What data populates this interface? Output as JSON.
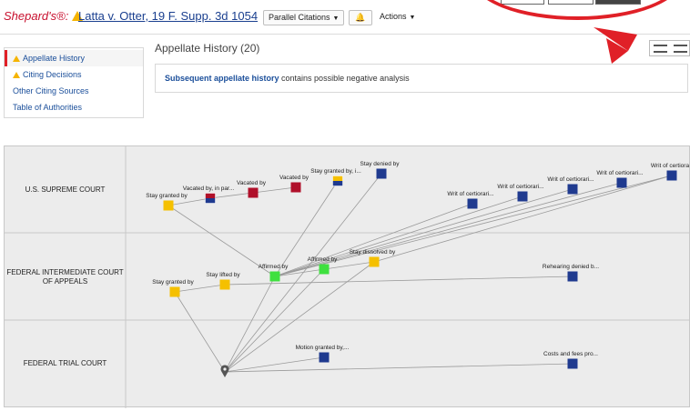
{
  "header": {
    "brand": "Shepard's®:",
    "case_title": "Latta v. Otter, 19 F. Supp. 3d 1054",
    "parallel_citations_label": "Parallel Citations",
    "actions_label": "Actions",
    "warning_color": "#f5b400",
    "brand_color": "#c8102e"
  },
  "sidenav": {
    "items": [
      {
        "label": "Appellate History",
        "warning": true,
        "active": true
      },
      {
        "label": "Citing Decisions",
        "warning": true,
        "active": false
      },
      {
        "label": "Other Citing Sources",
        "warning": false,
        "active": false
      },
      {
        "label": "Table of Authorities",
        "warning": false,
        "active": false
      }
    ]
  },
  "main": {
    "title": "Appellate History (20)",
    "notice_bold": "Subsequent appellate history",
    "notice_rest": " contains possible negative analysis"
  },
  "graph": {
    "courts": [
      "U.S. SUPREME COURT",
      "FEDERAL INTERMEDIATE COURT OF APPEALS",
      "FEDERAL TRIAL COURT"
    ],
    "colors": {
      "navy": "#1f3a8f",
      "yellow": "#f5c000",
      "green": "#3fe03f",
      "crimson": "#b0102a",
      "edge": "#9a9a9a"
    },
    "nodes": [
      {
        "id": "origin",
        "label": "",
        "kind": "pin"
      },
      {
        "id": "n1",
        "label": "Stay granted by",
        "kind": "yellow"
      },
      {
        "id": "n2",
        "label": "Vacated by, in par...",
        "kind": "split-crimson"
      },
      {
        "id": "n3",
        "label": "Vacated by",
        "kind": "crimson"
      },
      {
        "id": "n4",
        "label": "Vacated by",
        "kind": "crimson"
      },
      {
        "id": "n5",
        "label": "Stay granted by, i...",
        "kind": "split-yellow"
      },
      {
        "id": "n6",
        "label": "Stay denied by",
        "kind": "navy"
      },
      {
        "id": "n7",
        "label": "Writ of certiorari...",
        "kind": "navy"
      },
      {
        "id": "n8",
        "label": "Writ of certiorari...",
        "kind": "navy"
      },
      {
        "id": "n9",
        "label": "Writ of certiorari...",
        "kind": "navy"
      },
      {
        "id": "n10",
        "label": "Writ of certiorari...",
        "kind": "navy"
      },
      {
        "id": "n11",
        "label": "Writ of certiora",
        "kind": "navy"
      },
      {
        "id": "n12",
        "label": "Stay granted by",
        "kind": "yellow"
      },
      {
        "id": "n13",
        "label": "Stay lifted by",
        "kind": "yellow"
      },
      {
        "id": "n14",
        "label": "Affirmed by",
        "kind": "green"
      },
      {
        "id": "n15",
        "label": "Affirmed by",
        "kind": "green"
      },
      {
        "id": "n16",
        "label": "Stay dissolved by",
        "kind": "yellow"
      },
      {
        "id": "n17",
        "label": "Rehearing denied b...",
        "kind": "navy"
      },
      {
        "id": "n18",
        "label": "Motion granted by,...",
        "kind": "navy"
      },
      {
        "id": "n19",
        "label": "Costs and fees pro...",
        "kind": "navy"
      }
    ]
  }
}
